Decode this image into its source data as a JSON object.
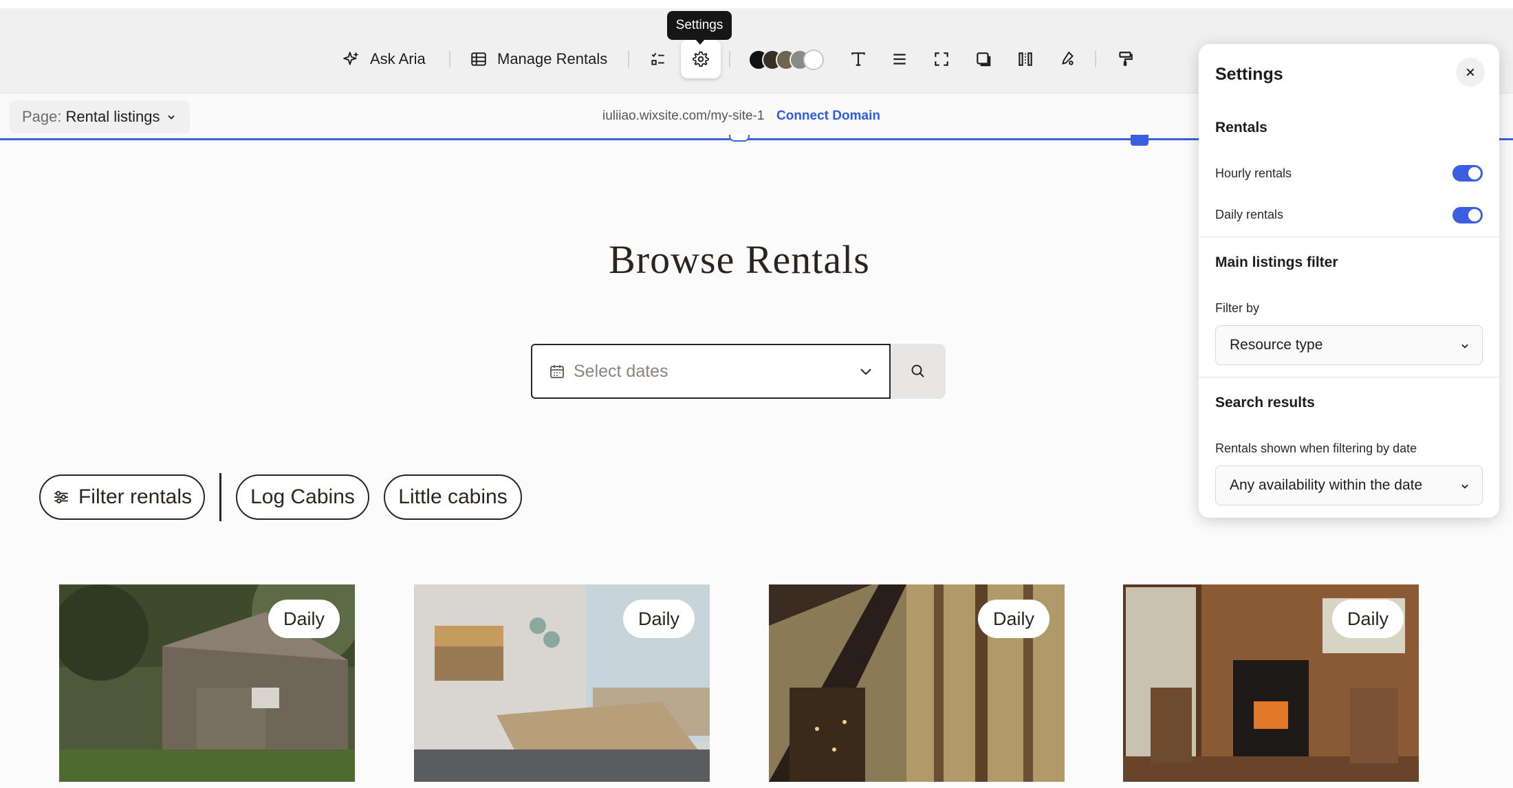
{
  "toolbar": {
    "ask_aria": "Ask Aria",
    "manage_rentals": "Manage Rentals",
    "tooltip": "Settings",
    "swatch_colors": [
      "#111111",
      "#3a2f25",
      "#6e6550",
      "#8a8a88",
      "#ffffff"
    ],
    "icons": [
      "sparkle-icon",
      "table-icon",
      "checklist-icon",
      "gear-icon",
      "text-icon",
      "align-icon",
      "resize-icon",
      "shadow-icon",
      "columns-icon",
      "brush-settings-icon",
      "paint-roller-icon"
    ]
  },
  "address_bar": {
    "page_label": "Page:",
    "page_value": "Rental listings",
    "url": "iuliiao.wixsite.com/my-site-1",
    "connect_domain": "Connect Domain"
  },
  "main": {
    "heading": "Browse Rentals",
    "date_placeholder": "Select dates",
    "filters": [
      "Filter rentals",
      "Log Cabins",
      "Little cabins"
    ],
    "cards": [
      {
        "badge": "Daily"
      },
      {
        "badge": "Daily"
      },
      {
        "badge": "Daily"
      },
      {
        "badge": "Daily"
      }
    ]
  },
  "settings_panel": {
    "title": "Settings",
    "rentals_heading": "Rentals",
    "hourly_label": "Hourly rentals",
    "hourly_on": true,
    "daily_label": "Daily rentals",
    "daily_on": true,
    "main_filter_heading": "Main listings filter",
    "filter_by_label": "Filter by",
    "filter_by_value": "Resource type",
    "search_results_heading": "Search results",
    "rentals_shown_label": "Rentals shown when filtering by date",
    "rentals_shown_value": "Any availability within the date"
  },
  "colors": {
    "accent": "#3b5fe0",
    "link": "#2f5be5",
    "text_dark": "#2b2520"
  }
}
